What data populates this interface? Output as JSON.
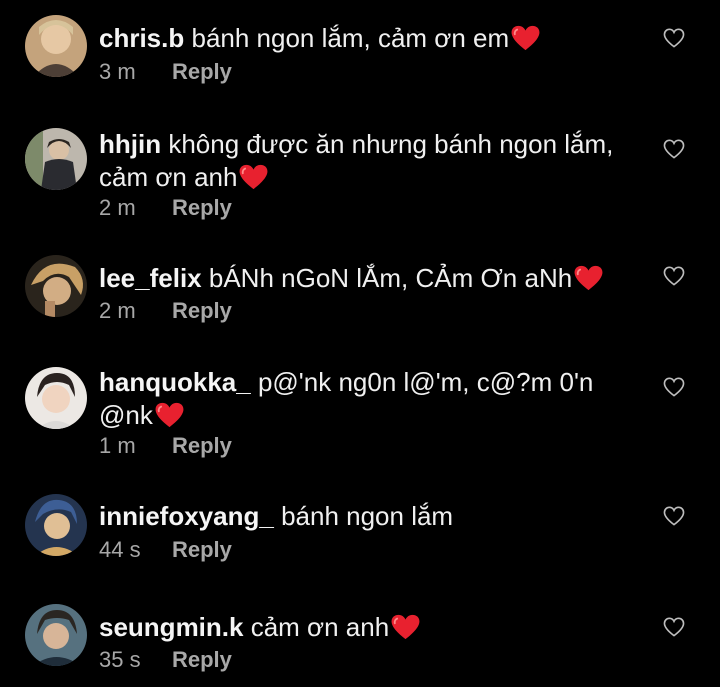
{
  "colors": {
    "background": "#000000",
    "text": "#f5f5f5",
    "secondary_text": "#a8a8a8",
    "heart_emoji": "#e8212f"
  },
  "icons": {
    "like": "heart-outline-icon",
    "emoji": "red-heart-emoji"
  },
  "comments": [
    {
      "username": "chris.b",
      "text": "bánh ngon lắm, cảm ơn em",
      "heart": true,
      "time": "3 m",
      "reply_label": "Reply",
      "avatar_colors": [
        "#d8b78f",
        "#5a4a3e",
        "#b77f60"
      ]
    },
    {
      "username": "hhjin",
      "text_line1": "không được ăn nhưng bánh ngon lắm,",
      "text_line2": "cảm ơn anh",
      "heart": true,
      "time": "2 m",
      "reply_label": "Reply",
      "avatar_colors": [
        "#c9c3b9",
        "#2e2f33",
        "#8a7d70"
      ]
    },
    {
      "username": "lee_felix",
      "text": "bÁNh nGoN lẮm, CẢm Ơn aNh",
      "heart": true,
      "time": "2 m",
      "reply_label": "Reply",
      "avatar_colors": [
        "#6b5a3a",
        "#1c1a16",
        "#c9a46d"
      ]
    },
    {
      "username": "hanquokka_",
      "text_line1": "p@'nk ng0n l@'m, c@?m 0'n",
      "text_line2": "@nk",
      "heart": true,
      "time": "1 m",
      "reply_label": "Reply",
      "avatar_colors": [
        "#e7e3e0",
        "#2b2522",
        "#c59a85"
      ]
    },
    {
      "username": "inniefoxyang_",
      "text": "bánh ngon lắm",
      "heart": false,
      "time": "44 s",
      "reply_label": "Reply",
      "avatar_colors": [
        "#3a5a8c",
        "#d3b07a",
        "#1f2d44"
      ]
    },
    {
      "username": "seungmin.k",
      "text": "cảm ơn anh",
      "heart": true,
      "time": "35 s",
      "reply_label": "Reply",
      "avatar_colors": [
        "#4f6d7f",
        "#1d252b",
        "#c7a58c"
      ]
    }
  ]
}
